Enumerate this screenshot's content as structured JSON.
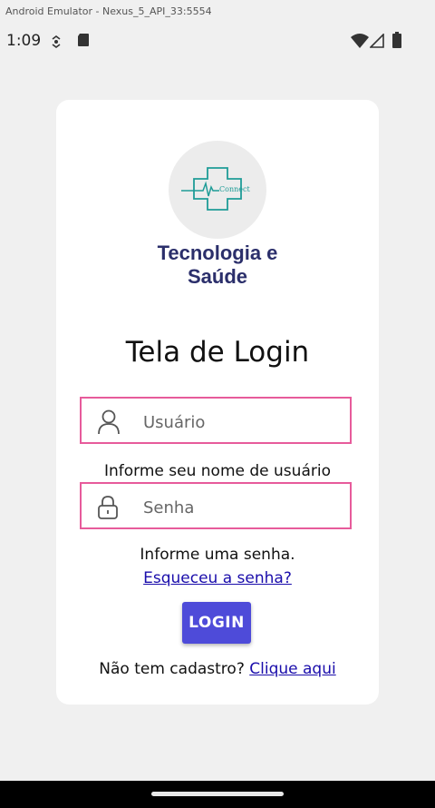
{
  "emulator": {
    "title": "Android Emulator - Nexus_5_API_33:5554"
  },
  "statusbar": {
    "time": "1:09"
  },
  "card": {
    "tagline_line1": "Tecnologia e",
    "tagline_line2": "Saúde",
    "logo_text": "Connect",
    "screen_title": "Tela de Login"
  },
  "username": {
    "placeholder": "Usuário",
    "value": "",
    "hint": "Informe seu nome de usuário"
  },
  "password": {
    "placeholder": "Senha",
    "value": "",
    "hint": "Informe uma senha."
  },
  "forgot_link": "Esqueceu a senha?",
  "login_button": "LOGIN",
  "signup": {
    "prompt": "Não tem cadastro?",
    "link": "Clique aqui"
  },
  "colors": {
    "accent": "#4e4bd9",
    "field_border": "#e75b9b",
    "tagline": "#2b2f6b",
    "logo_teal": "#1f9c97"
  }
}
